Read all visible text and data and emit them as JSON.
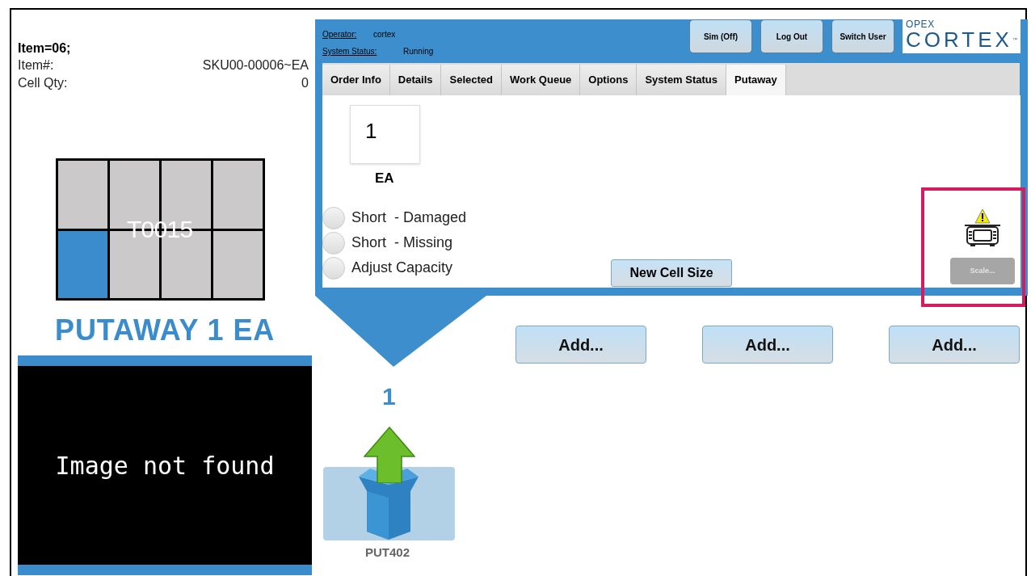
{
  "item": {
    "title": "Item=06;",
    "fields": [
      {
        "label": "Item#:",
        "value": "SKU00-00006~EA"
      },
      {
        "label": "Cell Qty:",
        "value": "0"
      }
    ]
  },
  "bin": {
    "label": "T0015",
    "cells": [
      {
        "selected": false
      },
      {
        "selected": false
      },
      {
        "selected": false
      },
      {
        "selected": false
      },
      {
        "selected": true
      },
      {
        "selected": false
      },
      {
        "selected": false
      },
      {
        "selected": false
      }
    ]
  },
  "instruction": "PUTAWAY 1 EA",
  "image_panel": {
    "message": "Image not found"
  },
  "header": {
    "operator": {
      "label": "Operator:",
      "value": "cortex"
    },
    "system_status": {
      "label": "System Status:",
      "value": "Running"
    },
    "buttons": [
      "Sim (Off)",
      "Log Out",
      "Switch User"
    ],
    "logo": {
      "brand": "OPEX",
      "product": "CORTEX",
      "mark": "™"
    }
  },
  "tabs": [
    {
      "label": "Order Info",
      "selected": false
    },
    {
      "label": "Details",
      "selected": false
    },
    {
      "label": "Selected",
      "selected": false
    },
    {
      "label": "Work Queue",
      "selected": false
    },
    {
      "label": "Options",
      "selected": false
    },
    {
      "label": "System Status",
      "selected": false
    },
    {
      "label": "Putaway",
      "selected": true
    }
  ],
  "putaway": {
    "quantity": "1",
    "unit": "EA",
    "options": [
      {
        "label": "Short  - Damaged",
        "checked": false
      },
      {
        "label": "Short  - Missing",
        "checked": false
      },
      {
        "label": "Adjust Capacity",
        "checked": false
      }
    ],
    "new_cell_size": "New Cell Size",
    "scale": {
      "label": "Scale...",
      "disabled": true,
      "warning": true
    }
  },
  "add_buttons": [
    "Add...",
    "Add...",
    "Add..."
  ],
  "target": {
    "quantity": "1",
    "location": "PUT402"
  }
}
